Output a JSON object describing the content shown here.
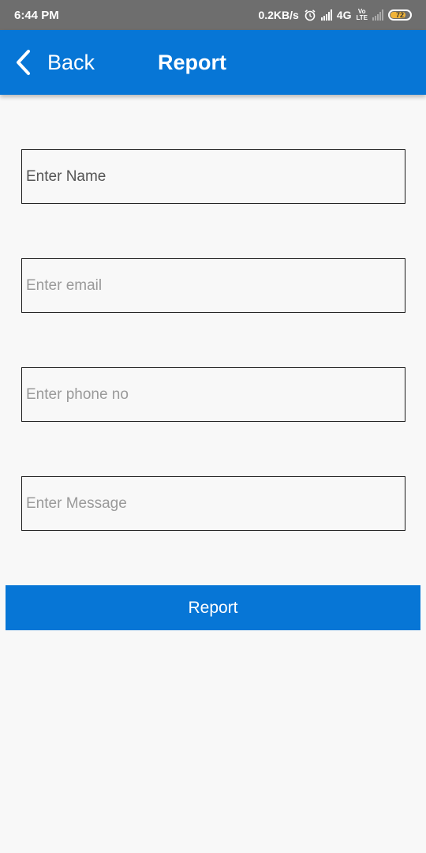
{
  "status_bar": {
    "time": "6:44 PM",
    "speed": "0.2KB/s",
    "network": "4G",
    "volte_top": "Vo",
    "volte_bottom": "LTE",
    "battery": "72",
    "icons": [
      "alarm-icon",
      "signal-icon",
      "signal-weak-icon",
      "battery-icon"
    ]
  },
  "app_bar": {
    "back_label": "Back",
    "title": "Report",
    "color": "#0776d6"
  },
  "form": {
    "name_placeholder": "Enter Name",
    "email_placeholder": "Enter email",
    "phone_placeholder": "Enter phone no",
    "message_placeholder": "Enter Message",
    "submit_label": "Report"
  }
}
